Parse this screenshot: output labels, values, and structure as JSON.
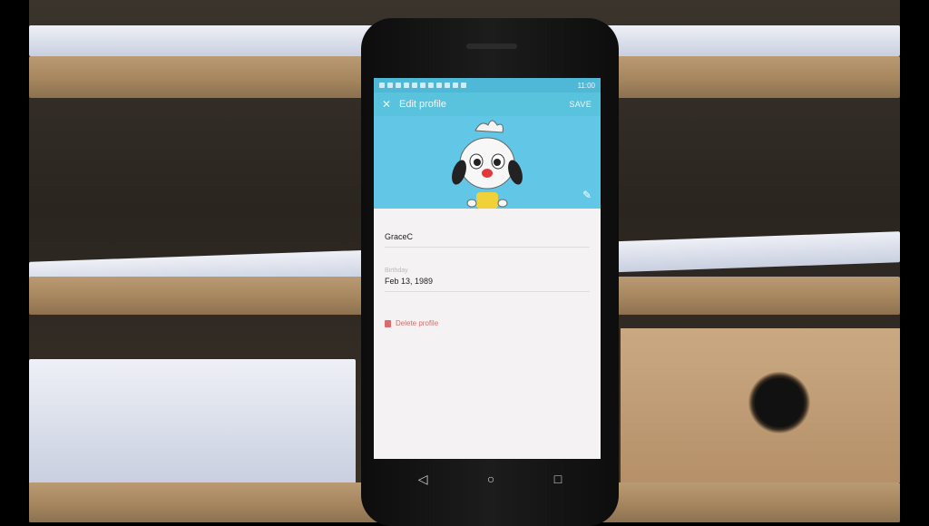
{
  "statusbar": {
    "time": "11:00"
  },
  "appbar": {
    "close_icon": "close-icon",
    "title": "Edit profile",
    "save_label": "SAVE"
  },
  "header": {
    "avatar": "cartoon-dog-avatar",
    "edit_icon": "pencil-icon"
  },
  "form": {
    "name_value": "GraceC",
    "birthday_label": "Birthday",
    "birthday_value": "Feb 13, 1989",
    "delete_label": "Delete profile"
  },
  "navbar": {
    "back": "back-icon",
    "home": "home-icon",
    "recents": "recents-icon"
  },
  "colors": {
    "accent": "#59c3dd",
    "header_bg": "#62c6e6",
    "delete": "#d86b6b"
  }
}
